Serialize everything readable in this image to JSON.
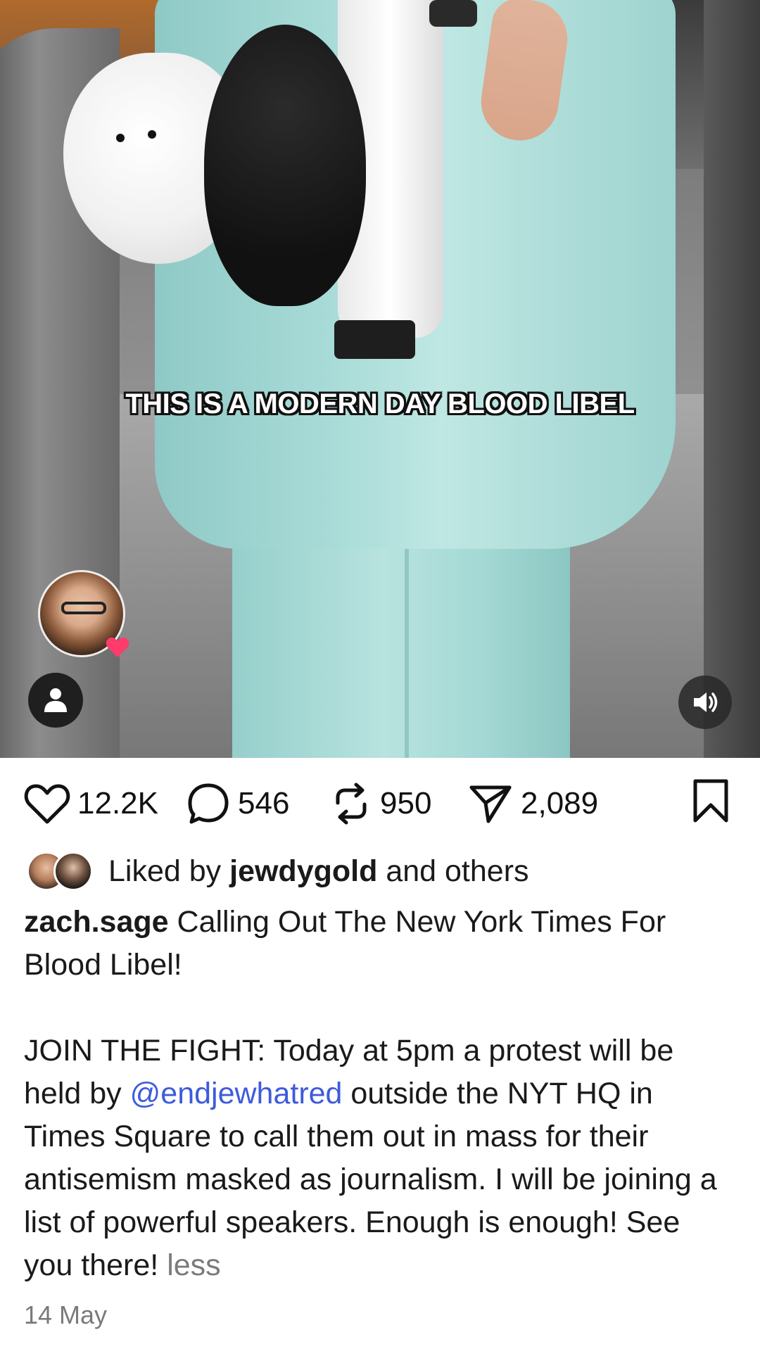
{
  "video": {
    "caption": "THIS IS A MODERN DAY BLOOD LIBEL",
    "collab_avatar_icon": "avatar-with-heart",
    "profile_icon": "person-icon",
    "mute_icon": "volume-icon"
  },
  "actions": {
    "likes": "12.2K",
    "comments": "546",
    "reposts": "950",
    "shares": "2,089"
  },
  "liked_by": {
    "prefix": "Liked by",
    "user": "jewdygold",
    "suffix": "and others"
  },
  "post": {
    "username": "zach.sage",
    "caption_line1": "Calling Out The New York Times For Blood Libel!",
    "caption_part2_before": "JOIN THE FIGHT: Today at 5pm a protest will be held by",
    "mention": "@endjewhatred",
    "caption_part2_after": "outside the NYT HQ in Times Square to call them out in mass for their antisemism masked as journalism. I will be joining a list of powerful speakers. Enough is enough! See you there!",
    "less_label": "less",
    "date": "14 May"
  },
  "colors": {
    "mention": "#3d5bdb",
    "heart_badge": "#ff3b6b",
    "muted_text": "#7a7a7a"
  }
}
